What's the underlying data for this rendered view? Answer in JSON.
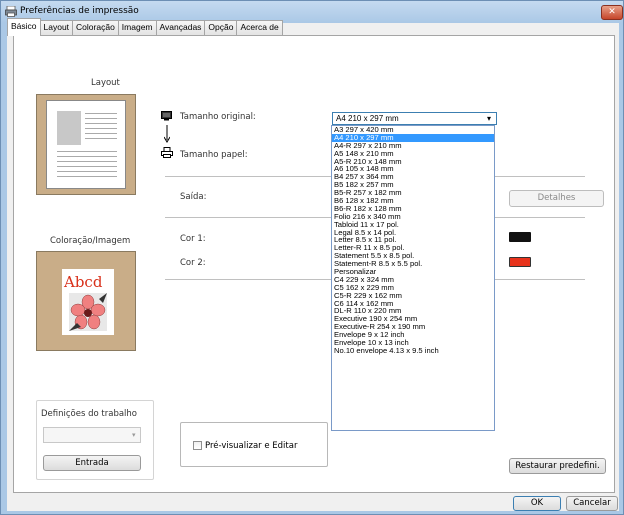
{
  "window": {
    "title": "Preferências de impressão",
    "close_label": "✕"
  },
  "tabs": [
    {
      "label": "Básico",
      "active": true
    },
    {
      "label": "Layout",
      "active": false
    },
    {
      "label": "Coloração",
      "active": false
    },
    {
      "label": "Imagem",
      "active": false
    },
    {
      "label": "Avançadas",
      "active": false
    },
    {
      "label": "Opção",
      "active": false
    },
    {
      "label": "Acerca de",
      "active": false
    }
  ],
  "left": {
    "layout_heading": "Layout",
    "color_heading": "Coloração/Imagem",
    "sample_text": "Abcd",
    "job_group_label": "Definições do trabalho",
    "job_select_value": "",
    "entrada_button": "Entrada"
  },
  "main": {
    "original_size_label": "Tamanho original:",
    "paper_size_label": "Tamanho papel:",
    "output_label": "Saída:",
    "color1_label": "Cor 1:",
    "color2_label": "Cor 2:",
    "details_button": "Detalhes",
    "preview_label": "Pré-visualizar e Editar",
    "restore_button": "Restaurar predefini.",
    "ok_button": "OK",
    "cancel_button": "Cancelar",
    "color1_value": "#111111",
    "color2_value": "#e8331c"
  },
  "size_dropdown": {
    "selected": "A4 210 x 297 mm",
    "options": [
      "A3 297 x 420 mm",
      "A4 210 x 297 mm",
      "A4-R 297 x 210 mm",
      "A5 148 x 210 mm",
      "A5-R 210 x 148 mm",
      "A6 105 x 148 mm",
      "B4 257 x 364 mm",
      "B5 182 x 257 mm",
      "B5-R 257 x 182 mm",
      "B6 128 x 182 mm",
      "B6-R 182 x 128 mm",
      "Folio 216 x 340 mm",
      "Tabloid 11 x 17 pol.",
      "Legal  8.5 x 14 pol.",
      "Letter 8.5 x 11 pol.",
      "Letter-R 11 x 8.5 pol.",
      "Statement 5.5 x 8.5 pol.",
      "Statement-R 8.5 x 5.5 pol.",
      "Personalizar",
      "C4 229 x 324 mm",
      "C5 162 x 229 mm",
      "C5-R 229 x 162 mm",
      "C6 114 x 162 mm",
      "DL-R 110 x 220 mm",
      "Executive 190 x 254 mm",
      "Executive-R 254 x 190 mm",
      "Envelope 9 x 12 inch",
      "Envelope 10 x 13 inch",
      "No.10 envelope 4.13 x 9.5 inch"
    ],
    "selected_index": 1
  }
}
